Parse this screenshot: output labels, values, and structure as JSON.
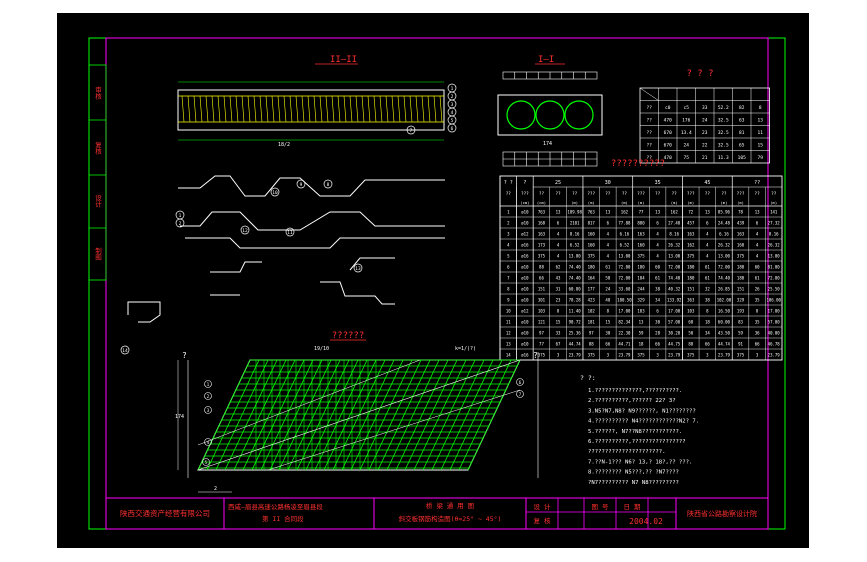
{
  "colors": {
    "background": "#000000",
    "outer": "#ffffff",
    "frame": "#ff00ff",
    "red": "#ff3030",
    "yellow": "#ffff00",
    "green": "#00ff00",
    "white": "#ffffff",
    "cyan": "#00ffff"
  },
  "titles": {
    "section_2": "II—II",
    "section_1": "I—I",
    "top_table": "? ? ?",
    "main_table": "??????????",
    "plan_title": "??????"
  },
  "side_labels": [
    "审核",
    "复核",
    "设计",
    "制图"
  ],
  "top_table": {
    "rows": [
      [
        "??",
        "c0",
        "c5",
        "33",
        "52.2",
        "82",
        "8"
      ],
      [
        "??",
        "470",
        "176",
        "24",
        "32.5",
        "63",
        "13"
      ],
      [
        "??",
        "670",
        "13.4",
        "23",
        "32.5",
        "81",
        "11"
      ],
      [
        "??",
        "670",
        "24",
        "22",
        "32.5",
        "65",
        "15"
      ],
      [
        "??",
        "470",
        "75",
        "21",
        "11.3",
        "105",
        "79"
      ]
    ]
  },
  "main_table": {
    "head1": [
      "? ?",
      "?",
      "25",
      "30",
      "35",
      "45",
      "??"
    ],
    "head2": [
      "??",
      "???",
      "??",
      "??",
      "??",
      "???",
      "??",
      "??",
      "???",
      "??",
      "??",
      "???",
      "??",
      "??",
      "???",
      "??",
      "??"
    ],
    "head3": [
      "",
      "(cm)",
      "(cm)",
      "",
      "(m)",
      "(m)",
      "",
      "(m)",
      "(m)",
      "",
      "(m)",
      "(m)",
      "",
      "(m)",
      "(m)",
      "",
      "(m)"
    ],
    "rows": [
      [
        "1",
        "ø10",
        "763",
        "13",
        "109.98",
        "763",
        "13",
        "162",
        "77",
        "13",
        "162",
        "72",
        "13",
        "85.96",
        "78",
        "13",
        "141"
      ],
      [
        "2",
        "ø10",
        "168",
        "6",
        "2101",
        "817",
        "6",
        "77.88",
        "880",
        "6",
        "27.48",
        "457",
        "6",
        "24.48",
        "439",
        "6",
        "27.32"
      ],
      [
        "3",
        "ø12",
        "163",
        "4",
        "8.16",
        "160",
        "4",
        "6.16",
        "163",
        "4",
        "8.16",
        "163",
        "4",
        "6.16",
        "163",
        "4",
        "8.16"
      ],
      [
        "4",
        "ø16",
        "173",
        "4",
        "6.52",
        "160",
        "4",
        "6.52",
        "160",
        "4",
        "26.32",
        "162",
        "4",
        "26.32",
        "160",
        "4",
        "26.32"
      ],
      [
        "5",
        "ø16",
        "375",
        "4",
        "13.00",
        "375",
        "4",
        "13.00",
        "375",
        "4",
        "13.00",
        "375",
        "4",
        "13.00",
        "375",
        "4",
        "13.00"
      ],
      [
        "6",
        "ø10",
        "88",
        "62",
        "74.40",
        "180",
        "61",
        "72.00",
        "180",
        "60",
        "72.00",
        "180",
        "61",
        "72.00",
        "180",
        "60",
        "81.00"
      ],
      [
        "7",
        "ø10",
        "66",
        "43",
        "74.40",
        "164",
        "50",
        "72.00",
        "184",
        "61",
        "74.40",
        "180",
        "61",
        "74.40",
        "180",
        "61",
        "72.00"
      ],
      [
        "8",
        "ø10",
        "151",
        "31",
        "60.80",
        "177",
        "24",
        "33.60",
        "244",
        "38",
        "40.32",
        "151",
        "32",
        "26.85",
        "151",
        "26",
        "25.50"
      ],
      [
        "9",
        "ø10",
        "301",
        "23",
        "78.28",
        "423",
        "48",
        "180.50",
        "329",
        "34",
        "133.92",
        "363",
        "38",
        "102.00",
        "329",
        "35",
        "106.00"
      ],
      [
        "10",
        "ø12",
        "103",
        "8",
        "11.40",
        "102",
        "8",
        "17.00",
        "103",
        "6",
        "17.00",
        "103",
        "8",
        "16.50",
        "193",
        "8",
        "17.00"
      ],
      [
        "11",
        "ø10",
        "121",
        "15",
        "90.72",
        "181",
        "15",
        "82.34",
        "13",
        "30",
        "57.00",
        "68",
        "18",
        "60.00",
        "83",
        "35",
        "57.00"
      ],
      [
        "12",
        "ø10",
        "97",
        "33",
        "25.36",
        "97",
        "30",
        "22.30",
        "59",
        "28",
        "30.20",
        "50",
        "34",
        "43.50",
        "59",
        "36",
        "40.00"
      ],
      [
        "13",
        "ø10",
        "77",
        "67",
        "44.74",
        "88",
        "66",
        "44.71",
        "18",
        "66",
        "44.75",
        "88",
        "66",
        "44.74",
        "91",
        "66",
        "46.78"
      ],
      [
        "14",
        "ø16",
        "375",
        "3",
        "23.79",
        "375",
        "3",
        "23.79",
        "375",
        "3",
        "23.79",
        "375",
        "3",
        "23.79",
        "375",
        "3",
        "23.79"
      ]
    ]
  },
  "notes": {
    "heading": "? ?:",
    "lines": [
      "1.??????????????,??????????.",
      "2.??????????,?????? 22? 3?",
      "3.N5?N7,N8? N9??????,  N1????????",
      "4.?????????? N4????????????N2? 7.",
      "5.??????, N7??N8???????????.",
      "6.??????????,????????????????",
      "  ??????????????????????.",
      "7.??N-1??? N6? 13,? 18?,??   ???.",
      "8.????????     N5???,?? ?N7????",
      "  ?N7?????????  N7  N8?????????"
    ]
  },
  "labels": {
    "dims": [
      "15|100",
      "100",
      "1000",
      "1000",
      "1000",
      "100",
      "100",
      "45",
      "3",
      "15",
      "22.5",
      "2.5",
      "n=15",
      "n=20",
      "n=150",
      "ø16",
      "n=10",
      "ø16",
      "110",
      "18/2"
    ],
    "circle_nums": [
      "1",
      "2",
      "3",
      "4",
      "5",
      "6",
      "7",
      "8",
      "9",
      "10",
      "11",
      "12",
      "13",
      "14"
    ],
    "plan_dims": [
      "19/10",
      "k=1/(?)",
      "174",
      "150",
      "2",
      "?",
      "?"
    ],
    "section1_dims": [
      "174",
      "49",
      "49",
      "49",
      "49",
      "42",
      "45",
      "h1",
      "h2",
      "h3"
    ],
    "bar_marks": [
      "ø10",
      "ø10",
      "ø12",
      "ø16",
      "ø16",
      "ø10",
      "ø10"
    ]
  },
  "title_block": {
    "company": "陕西交通资产经营有限公司",
    "project_line1": "西咸—眉县高速公路杨凌至眉县段",
    "project_line2": "第 II 合同段",
    "drawing_line1": "桥 梁 通 用 图",
    "drawing_line2": "斜交板钢筋构造图(θ=25° ~ 45°)",
    "design_label": "设 计",
    "review_label": "复 核",
    "approve_label": "审 核",
    "drawing_no_label": "图 号",
    "date_label": "日 期",
    "date_value": "2004.02",
    "designer_org": "陕西省公路勘察设计院"
  }
}
